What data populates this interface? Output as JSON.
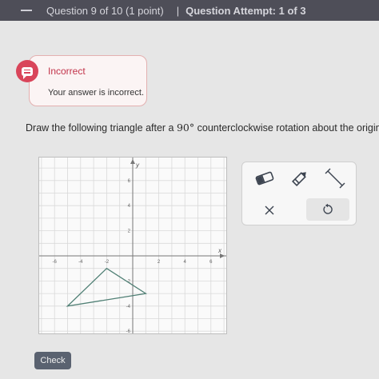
{
  "header": {
    "question_title": "Question 9 of 10 (1 point)",
    "separator": "|",
    "attempt_label": "Question Attempt: 1 of 3"
  },
  "feedback": {
    "title": "Incorrect",
    "message": "Your answer is incorrect.",
    "accent_color": "#d9455a"
  },
  "prompt": {
    "before": "Draw the following triangle after a ",
    "degrees": "90°",
    "after": " counterclockwise rotation about the origin."
  },
  "graph": {
    "axis_label_y": "y",
    "axis_label_x": "x",
    "x_range": [
      -8,
      8
    ],
    "y_range": [
      -8,
      8
    ],
    "x_tick_labels": [
      "-6",
      "-4",
      "-2",
      "2",
      "4",
      "6"
    ],
    "y_tick_labels": [
      "6",
      "4",
      "2",
      "-2",
      "-4",
      "-6"
    ],
    "triangle_vertices": [
      [
        -2,
        -1
      ],
      [
        -5,
        -4
      ],
      [
        1,
        -3
      ]
    ]
  },
  "toolbox": {
    "tools": [
      "eraser-icon",
      "pencil-icon",
      "line-segment-icon",
      "close-icon",
      "undo-icon"
    ]
  },
  "footer": {
    "check_label": "Check"
  }
}
